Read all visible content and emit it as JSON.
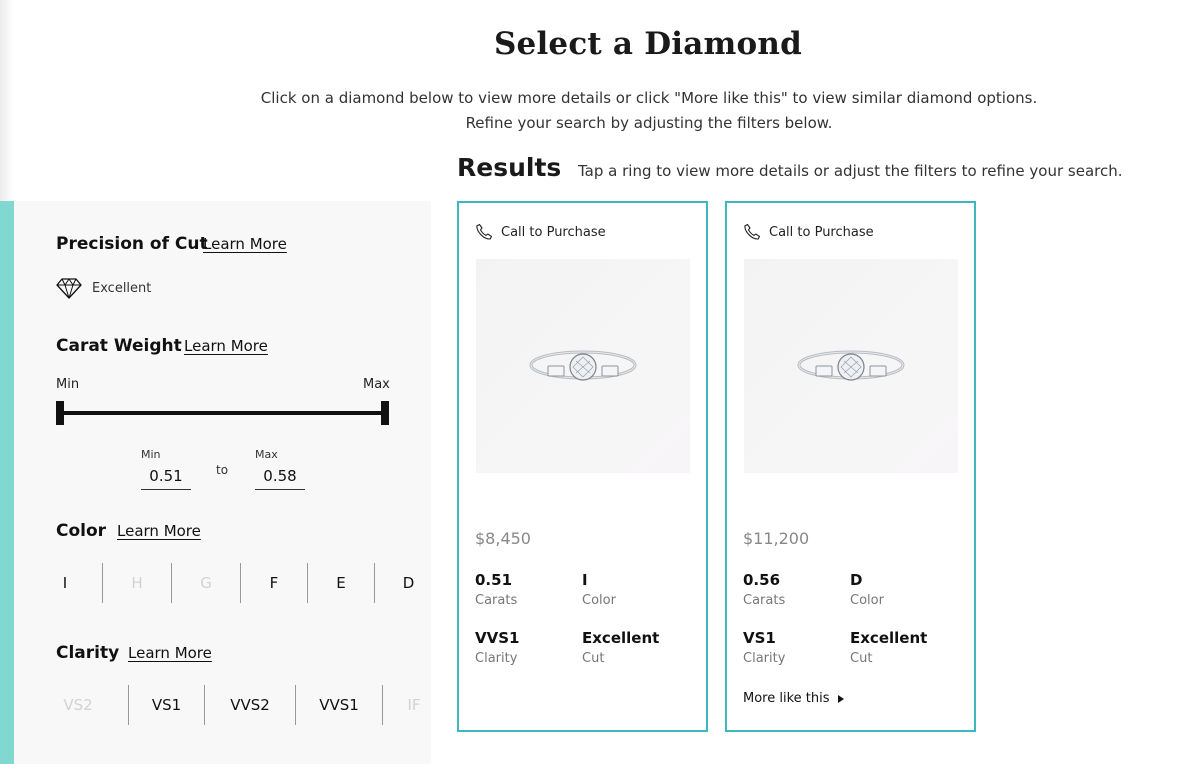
{
  "header": {
    "title": "Select a Diamond",
    "subtitle": "Click on a diamond below to view more details or click \"More like this\" to view similar diamond options. Refine your search by adjusting the filters below."
  },
  "results": {
    "heading": "Results",
    "hint": "Tap a ring to view more details or adjust the filters to refine your search."
  },
  "filters": {
    "cut": {
      "title": "Precision of Cut",
      "learn_more": "Learn More",
      "value": "Excellent",
      "icon": "diamond-icon"
    },
    "carat": {
      "title": "Carat Weight",
      "learn_more": "Learn More",
      "min_label": "Min",
      "max_label": "Max",
      "input_min_label": "Min",
      "input_max_label": "Max",
      "min_value": "0.51",
      "max_value": "0.58",
      "to": "to"
    },
    "color": {
      "title": "Color",
      "learn_more": "Learn More",
      "options": [
        {
          "label": "I",
          "active": true
        },
        {
          "label": "H",
          "active": false
        },
        {
          "label": "G",
          "active": false
        },
        {
          "label": "F",
          "active": true
        },
        {
          "label": "E",
          "active": true
        },
        {
          "label": "D",
          "active": true
        }
      ]
    },
    "clarity": {
      "title": "Clarity",
      "learn_more": "Learn More",
      "options": [
        {
          "label": "VS2",
          "active": false
        },
        {
          "label": "VS1",
          "active": true
        },
        {
          "label": "VVS2",
          "active": true
        },
        {
          "label": "VVS1",
          "active": true
        },
        {
          "label": "IF",
          "active": false
        }
      ]
    }
  },
  "cards": [
    {
      "call_label": "Call to Purchase",
      "price": "$8,450",
      "carats": "0.51",
      "carats_label": "Carats",
      "color": "I",
      "color_label": "Color",
      "clarity": "VVS1",
      "clarity_label": "Clarity",
      "cut": "Excellent",
      "cut_label": "Cut"
    },
    {
      "call_label": "Call to Purchase",
      "price": "$11,200",
      "carats": "0.56",
      "carats_label": "Carats",
      "color": "D",
      "color_label": "Color",
      "clarity": "VS1",
      "clarity_label": "Clarity",
      "cut": "Excellent",
      "cut_label": "Cut",
      "more_like_this": "More like this"
    }
  ],
  "colors": {
    "accent": "#81d8d0",
    "card_border": "#3cb8c2",
    "panel_bg": "#f8f8f8"
  },
  "icons": [
    "diamond-icon",
    "phone-icon",
    "ring-icon",
    "chevron-right-icon"
  ]
}
